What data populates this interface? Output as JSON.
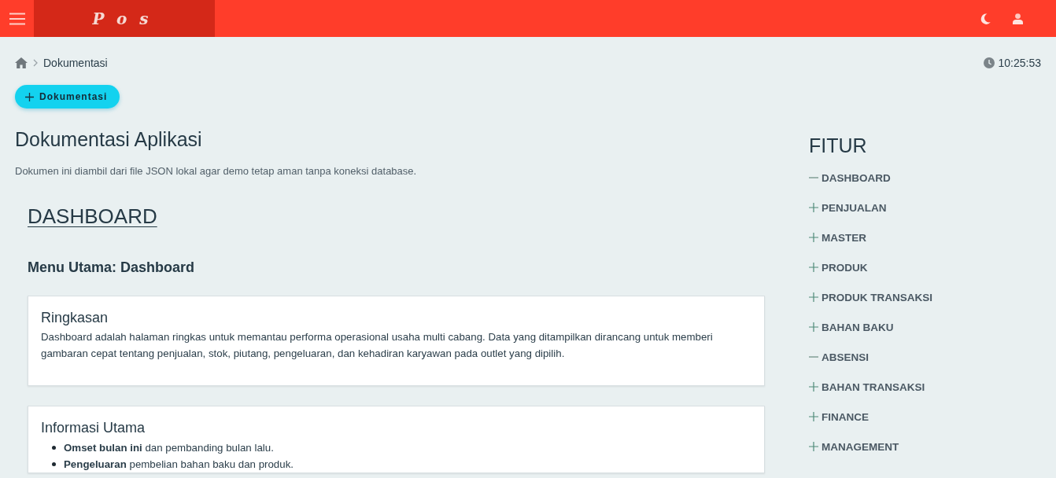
{
  "header": {
    "logo": "Pos"
  },
  "breadcrumb": {
    "items": [
      "Dokumentasi"
    ]
  },
  "clock": "10:25:53",
  "add_button": {
    "label": "Dokumentasi"
  },
  "page": {
    "title": "Dokumentasi Aplikasi",
    "subtitle": "Dokumen ini diambil dari file JSON lokal agar demo tetap aman tanpa koneksi database."
  },
  "section": {
    "title": "DASHBOARD",
    "subtitle": "Menu Utama: Dashboard",
    "cards": [
      {
        "kind": "paragraph",
        "title": "Ringkasan",
        "text": "Dashboard adalah halaman ringkas untuk memantau performa operasional usaha multi cabang. Data yang ditampilkan dirancang untuk memberi gambaran cepat tentang penjualan, stok, piutang, pengeluaran, dan kehadiran karyawan pada outlet yang dipilih."
      },
      {
        "kind": "list",
        "title": "Informasi Utama",
        "items": [
          "**Omset bulan ini** dan pembanding bulan lalu.",
          "**Pengeluaran** pembelian bahan baku dan produk."
        ]
      }
    ]
  },
  "sidebar": {
    "title": "FITUR",
    "items": [
      {
        "label": "DASHBOARD",
        "expanded": true
      },
      {
        "label": "PENJUALAN",
        "expanded": false
      },
      {
        "label": "MASTER",
        "expanded": false
      },
      {
        "label": "PRODUK",
        "expanded": false
      },
      {
        "label": "PRODUK TRANSAKSI",
        "expanded": false
      },
      {
        "label": "BAHAN BAKU",
        "expanded": false
      },
      {
        "label": "ABSENSI",
        "expanded": true
      },
      {
        "label": "BAHAN TRANSAKSI",
        "expanded": false
      },
      {
        "label": "FINANCE",
        "expanded": false
      },
      {
        "label": "MANAGEMENT",
        "expanded": false
      }
    ]
  }
}
